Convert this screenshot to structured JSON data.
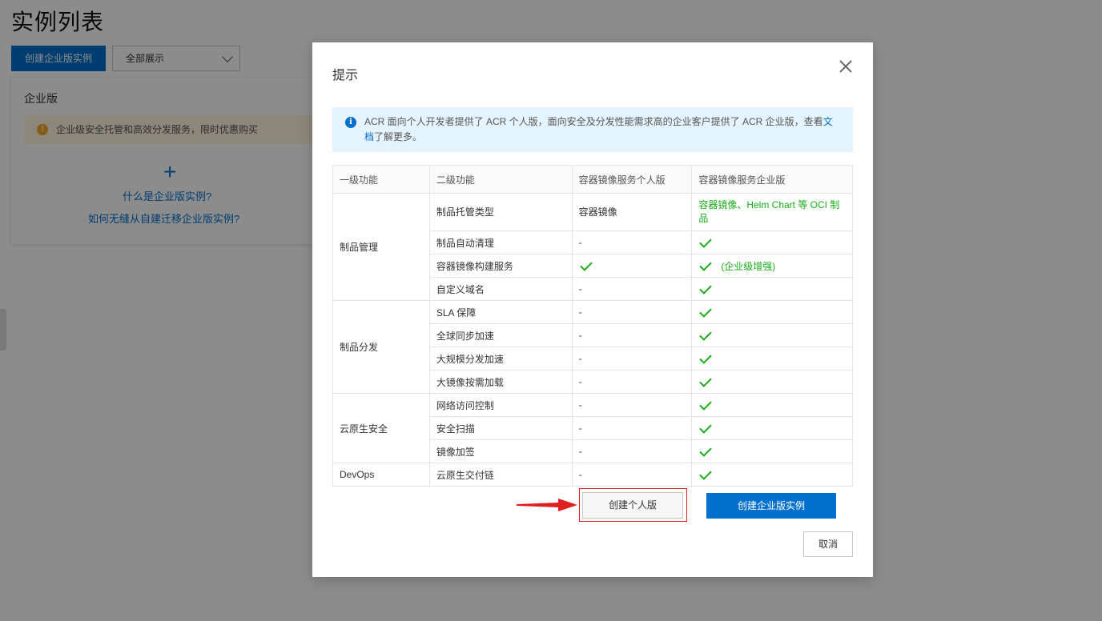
{
  "background": {
    "page_title": "实例列表",
    "create_button": "创建企业版实例",
    "filter_select": "全部展示",
    "card": {
      "title": "企业版",
      "warning": "企业级安全托管和高效分发服务，限时优惠购买",
      "link1": "什么是企业版实例?",
      "link2": "如何无缝从自建迁移企业版实例?"
    }
  },
  "dialog": {
    "title": "提示",
    "notice_text_before": "ACR 面向个人开发者提供了 ACR 个人版，面向安全及分发性能需求高的企业客户提供了 ACR 企业版，查看",
    "notice_link": "文档",
    "notice_text_after": "了解更多。",
    "table": {
      "headers": [
        "一级功能",
        "二级功能",
        "容器镜像服务个人版",
        "容器镜像服务企业版"
      ],
      "groups": [
        {
          "name": "制品管理",
          "rows": [
            {
              "feature": "制品托管类型",
              "personal": "容器镜像",
              "enterprise_text": "容器镜像、Helm Chart 等 OCI 制品"
            },
            {
              "feature": "制品自动清理",
              "personal": "-",
              "enterprise_check": true
            },
            {
              "feature": "容器镜像构建服务",
              "personal_check": true,
              "enterprise_check": true,
              "enterprise_note": "(企业级增强)"
            },
            {
              "feature": "自定义域名",
              "personal": "-",
              "enterprise_check": true
            }
          ]
        },
        {
          "name": "制品分发",
          "rows": [
            {
              "feature": "SLA 保障",
              "personal": "-",
              "enterprise_check": true
            },
            {
              "feature": "全球同步加速",
              "personal": "-",
              "enterprise_check": true
            },
            {
              "feature": "大规模分发加速",
              "personal": "-",
              "enterprise_check": true
            },
            {
              "feature": "大镜像按需加载",
              "personal": "-",
              "enterprise_check": true
            }
          ]
        },
        {
          "name": "云原生安全",
          "rows": [
            {
              "feature": "网络访问控制",
              "personal": "-",
              "enterprise_check": true
            },
            {
              "feature": "安全扫描",
              "personal": "-",
              "enterprise_check": true
            },
            {
              "feature": "镜像加签",
              "personal": "-",
              "enterprise_check": true
            }
          ]
        },
        {
          "name": "DevOps",
          "rows": [
            {
              "feature": "云原生交付链",
              "personal": "-",
              "enterprise_check": true
            }
          ]
        }
      ]
    },
    "buttons": {
      "personal": "创建个人版",
      "enterprise": "创建企业版实例",
      "cancel": "取消"
    }
  },
  "colors": {
    "primary": "#0070cc",
    "success": "#1aad19",
    "highlight": "#e02020"
  }
}
